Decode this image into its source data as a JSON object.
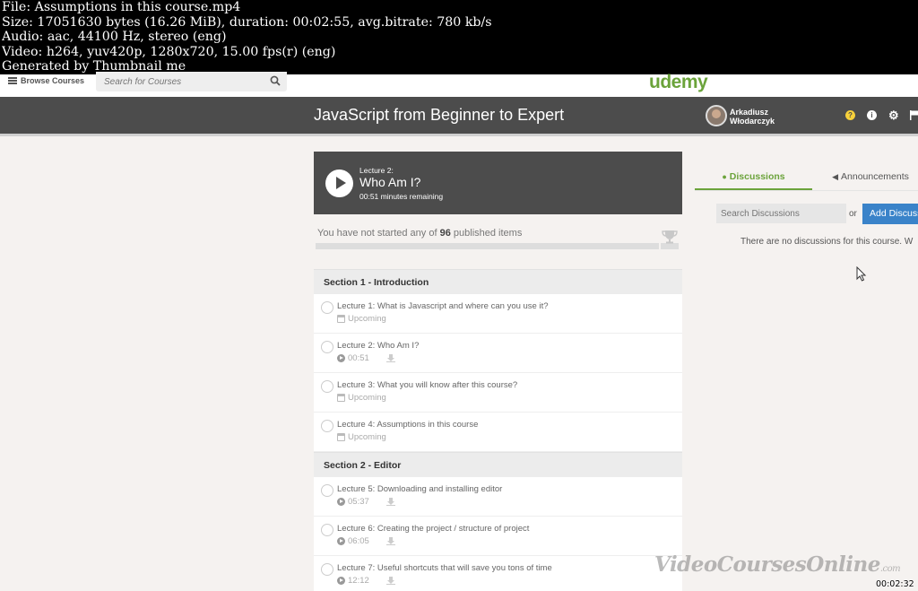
{
  "file_info": {
    "line1": "File: Assumptions in this course.mp4",
    "line2": "Size: 17051630 bytes (16.26 MiB), duration: 00:02:55, avg.bitrate: 780 kb/s",
    "line3": "Audio: aac, 44100 Hz, stereo (eng)",
    "line4": "Video: h264, yuv420p, 1280x720, 15.00 fps(r) (eng)",
    "line5": "Generated by Thumbnail me"
  },
  "nav": {
    "browse_label": "Browse Courses",
    "search_placeholder": "Search for Courses",
    "logo": "udemy"
  },
  "course": {
    "title": "JavaScript from Beginner to Expert",
    "user_first": "Arkadiusz",
    "user_last": "Włodarczyk"
  },
  "player": {
    "lecture_number": "Lecture 2:",
    "lecture_title": "Who Am I?",
    "remaining": "00:51 minutes remaining"
  },
  "progress": {
    "prefix": "You have not started any of ",
    "count": "96",
    "suffix": " published items",
    "fraction": 0
  },
  "sections": [
    {
      "title": "Section 1 - Introduction",
      "lectures": [
        {
          "title": "Lecture 1: What is Javascript and where can you use it?",
          "meta": "Upcoming",
          "type": "upcoming"
        },
        {
          "title": "Lecture 2: Who Am I?",
          "meta": "00:51",
          "type": "video"
        },
        {
          "title": "Lecture 3: What you will know after this course?",
          "meta": "Upcoming",
          "type": "upcoming"
        },
        {
          "title": "Lecture 4: Assumptions in this course",
          "meta": "Upcoming",
          "type": "upcoming"
        }
      ]
    },
    {
      "title": "Section 2 - Editor",
      "lectures": [
        {
          "title": "Lecture 5: Downloading and installing editor",
          "meta": "05:37",
          "type": "video"
        },
        {
          "title": "Lecture 6: Creating the project / structure of project",
          "meta": "06:05",
          "type": "video"
        },
        {
          "title": "Lecture 7: Useful shortcuts that will save you tons of time",
          "meta": "12:12",
          "type": "video"
        }
      ]
    }
  ],
  "discussions": {
    "tab_discussions": "Discussions",
    "tab_announcements": "Announcements",
    "search_placeholder": "Search Discussions",
    "or_label": "or",
    "add_button": "Add Discussion",
    "empty_text": "There are no discussions for this course. W"
  },
  "watermark": {
    "main": "VideoCoursesOnline",
    "suffix": ".com"
  },
  "timestamp": "00:02:32",
  "colors": {
    "accent_green": "#6ba33b",
    "button_blue": "#3a83c9",
    "header_gray": "#4c4c4c",
    "help_yellow": "#f7d13b"
  }
}
